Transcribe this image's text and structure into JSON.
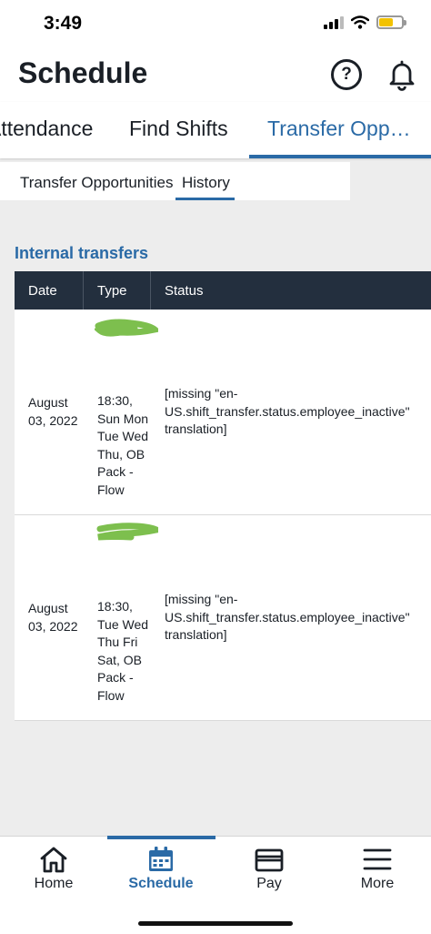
{
  "status_bar": {
    "time": "3:49"
  },
  "header": {
    "title": "Schedule",
    "help_label": "?"
  },
  "top_tabs": [
    {
      "label": "Attendance"
    },
    {
      "label": "Find Shifts"
    },
    {
      "label": "Transfer Opp…",
      "active": true
    }
  ],
  "sub_tabs": [
    {
      "label": "Transfer Opportunities"
    },
    {
      "label": "History",
      "active": true
    }
  ],
  "section": {
    "title": "Internal transfers"
  },
  "table": {
    "columns": [
      "Date",
      "Type",
      "Status"
    ],
    "rows": [
      {
        "date": "August 03, 2022",
        "type": "18:30, Sun Mon Tue Wed Thu, OB Pack - Flow",
        "status": "[missing \"en-US.shift_transfer.status.employee_inactive\" translation]"
      },
      {
        "date": "August 03, 2022",
        "type": "18:30, Tue Wed Thu Fri Sat, OB Pack - Flow",
        "status": "[missing \"en-US.shift_transfer.status.employee_inactive\" translation]"
      }
    ]
  },
  "bottom_nav": {
    "items": [
      {
        "label": "Home",
        "icon": "home-icon"
      },
      {
        "label": "Schedule",
        "icon": "calendar-icon",
        "active": true
      },
      {
        "label": "Pay",
        "icon": "wallet-icon"
      },
      {
        "label": "More",
        "icon": "menu-icon"
      }
    ]
  },
  "colors": {
    "accent": "#2a6aa6",
    "table_header": "#232f3e",
    "redaction": "#7dbf4e"
  }
}
